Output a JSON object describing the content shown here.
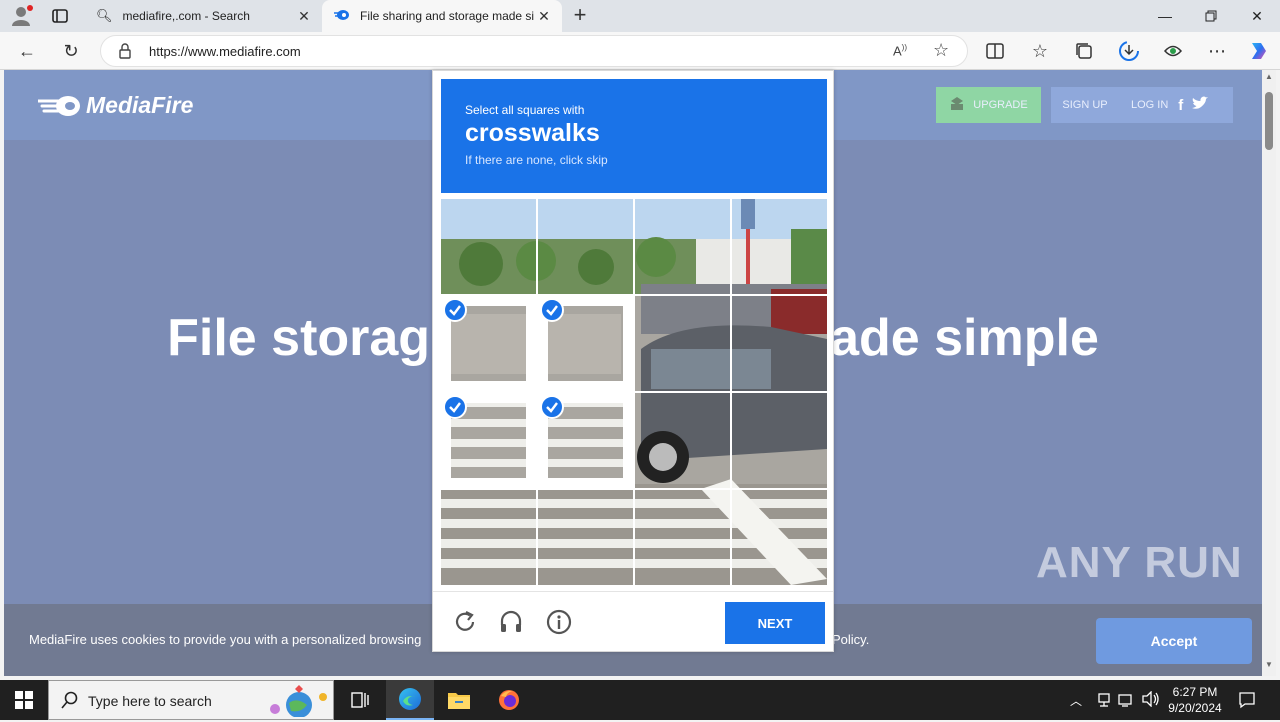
{
  "browser": {
    "tabs": [
      {
        "title": "mediafire,.com - Search",
        "active": false
      },
      {
        "title": "File sharing and storage made sin",
        "active": true
      }
    ],
    "url": "https://www.mediafire.com",
    "icons": [
      "profile-icon",
      "tab-actions-icon",
      "search-icon",
      "mediafire-favicon",
      "new-tab-icon",
      "minimize-icon",
      "restore-icon",
      "close-icon",
      "back-icon",
      "refresh-icon",
      "lock-icon",
      "read-aloud-icon",
      "favorite-star-icon",
      "split-screen-icon",
      "favorites-icon",
      "collections-icon",
      "downloads-icon",
      "extensions-icon",
      "more-icon",
      "copilot-icon"
    ]
  },
  "page": {
    "logo_text": "MediaFire",
    "header_buttons": {
      "upgrade": "UPGRADE",
      "signup": "SIGN UP",
      "login": "LOG IN"
    },
    "hero_left": "File storag",
    "hero_right": "ade simple",
    "cookie_text": "MediaFire uses cookies to provide you with a personalized browsing",
    "cookie_text_end": "Policy.",
    "accept_label": "Accept",
    "watermark": "ANY RUN",
    "colors": {
      "page_bg": "#7c8cb5",
      "header_bg": "#8097c6",
      "accent": "#1a73e8",
      "upgrade_bg": "#8fd6a4"
    }
  },
  "captcha": {
    "instruction": "Select all squares with",
    "target": "crosswalks",
    "hint": "If there are none, click skip",
    "grid_rows": 4,
    "grid_cols": 4,
    "selected_cells": [
      4,
      5,
      8,
      9
    ],
    "next_label": "NEXT",
    "footer_icons": [
      "refresh-icon",
      "audio-icon",
      "info-icon"
    ]
  },
  "taskbar": {
    "search_placeholder": "Type here to search",
    "time": "6:27 PM",
    "date": "9/20/2024",
    "icons": [
      "windows-start-icon",
      "search-icon",
      "task-view-icon",
      "edge-icon",
      "file-explorer-icon",
      "firefox-icon",
      "chevron-up-icon",
      "network-icon",
      "volume-icon",
      "notification-icon"
    ]
  }
}
